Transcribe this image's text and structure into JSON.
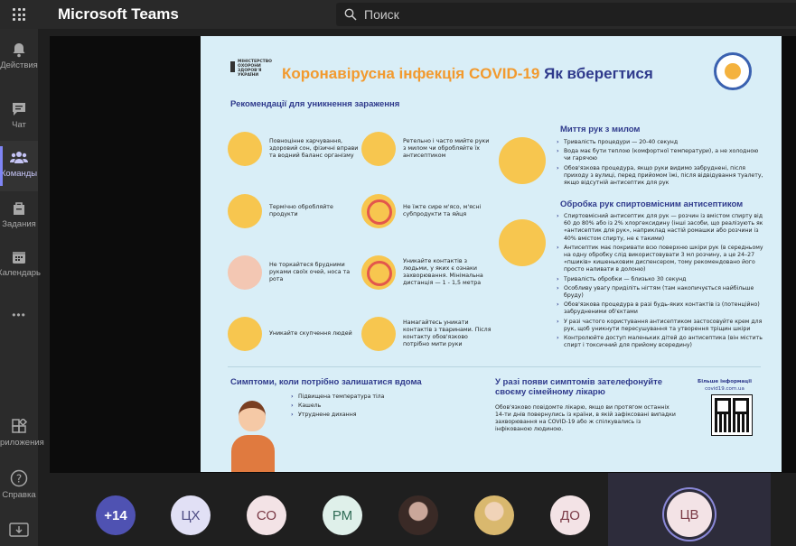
{
  "app": {
    "title": "Microsoft Teams"
  },
  "search": {
    "placeholder": "Поиск"
  },
  "rail": {
    "items": [
      {
        "label": "Действия",
        "icon": "bell-icon"
      },
      {
        "label": "Чат",
        "icon": "chat-icon"
      },
      {
        "label": "Команды",
        "icon": "teams-icon",
        "active": true
      },
      {
        "label": "Задания",
        "icon": "assignments-icon"
      },
      {
        "label": "Календарь",
        "icon": "calendar-icon"
      },
      {
        "label": "•••",
        "icon": "more-icon"
      }
    ],
    "bottom": [
      {
        "label": "Приложения",
        "icon": "apps-icon"
      },
      {
        "label": "Справка",
        "icon": "help-icon"
      }
    ]
  },
  "slide": {
    "ministry": "МІНІСТЕРСТВО ОХОРОНИ ЗДОРОВ'Я УКРАЇНИ",
    "title_orange": "Коронавірусна інфекція COVID-19",
    "title_blue": "Як вберегтися",
    "recommend_heading": "Рекомендації для уникнення зараження",
    "tips": [
      "Повноцінне харчування, здоровий сон, фізичні вправи та водний баланс організму",
      "Термічно обробляйте продукти",
      "Не торкайтеся брудними руками своїх очей, носа та рота",
      "Уникайте скупчення людей"
    ],
    "tips2": [
      "Ретельно і часто мийте руки з милом чи обробляйте їх антисептиком",
      "Не їжте сире м'ясо, м'ясні субпродукти та яйця",
      "Уникайте контактів з людьми, у яких є ознаки захворювання. Мінімальна дистанція — 1 - 1,5 метра",
      "Намагайтесь уникати контактів з тваринами. Після контакту обов'язково потрібно мити руки"
    ],
    "wash_heading": "Миття рук з милом",
    "wash": [
      "Тривалість процедури — 20-40 секунд",
      "Вода має бути теплою (комфортної температури), а не холодною чи гарячою",
      "Обов'язкова процедура, якщо руки видимо забруднені, після приходу з вулиці, перед прийомом їжі, після відвідування туалету, якщо відсутній антисептик для рук"
    ],
    "sanitize_heading": "Обробка рук спиртовмісним антисептиком",
    "sanitize": [
      "Спиртовмісний антисептик для рук — розчин із вмістом спирту від 60 до 80% або із 2% хлоргексидину (інші засоби, що реалізують як «антисептик для рук», наприклад настій ромашки або розчини із 40% вмістом спирту, не є такими)",
      "Антисептик має покривати всю поверхню шкіри рук (в середньому на одну обробку слід використовувати 3 мл розчину, а це 24–27 «пшиків» кишеньковим диспенсером, тому рекомендовано його просто наливати в долоню)",
      "Тривалість обробки — близько 30 секунд",
      "Особливу увагу приділіть нігтям (там накопичується найбільше бруду)",
      "Обов'язкова процедура в разі будь-яких контактів із (потенційно) забрудненими об'єктами",
      "У разі частого користування антисептиком застосовуйте крем для рук, щоб уникнути пересушування та утворення тріщин шкіри",
      "Контролюйте доступ маленьких дітей до антисептика (він містить спирт і токсичний для прийому всередину)"
    ],
    "symptoms_heading": "Симптоми, коли потрібно залишатися вдома",
    "symptoms": [
      "Підвищена температура тіла",
      "Кашель",
      "Утруднене дихання"
    ],
    "call_heading": "У разі появи симптомів зателефонуйте своєму сімейному лікарю",
    "call_text": "Обов'язково повідомте лікарю, якщо ви протягом останніх 14-ти днів повернулись із країни, в якій зафіксовані випадки захворювання на COVID-19 або ж спілкувались із інфікованою людиною.",
    "more_label": "Більше інформації",
    "more_url": "covid19.com.ua"
  },
  "participants": {
    "overflow": "+14",
    "avatars": [
      "ЦХ",
      "СО",
      "РМ",
      "ДО"
    ],
    "speaker": "ЦВ"
  },
  "colors": {
    "accent": "#7f85f5",
    "slide_bg": "#d9eef7",
    "title_orange": "#f29a2e",
    "title_blue": "#2f3a8c"
  }
}
